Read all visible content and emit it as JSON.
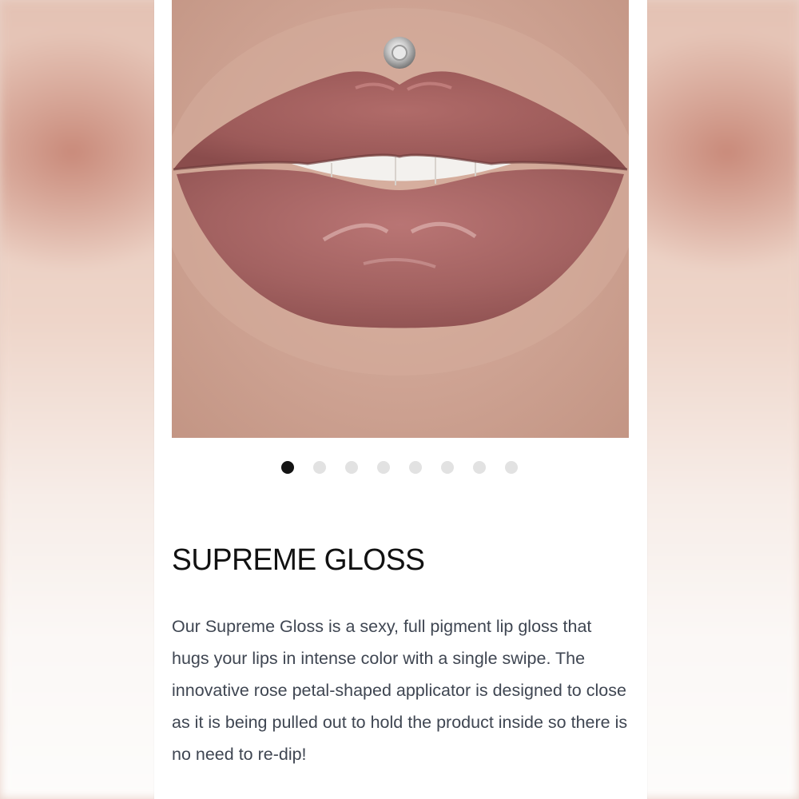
{
  "product": {
    "title": "SUPREME GLOSS",
    "description": "Our Supreme Gloss is a sexy, full pigment lip gloss that hugs your lips in intense color with a single swipe. The innovative rose petal-shaped applicator is designed to close as it is being pulled out to hold the product inside so there is no need to re-dip!",
    "image_icon": "lips-photo-icon"
  },
  "carousel": {
    "slide_count": 8,
    "active_index": 0
  },
  "colors": {
    "lip": "#a4605f",
    "skin": "#d3a898",
    "active_dot": "#141414",
    "inactive_dot": "#e2e2e2",
    "text": "#3f4652"
  }
}
